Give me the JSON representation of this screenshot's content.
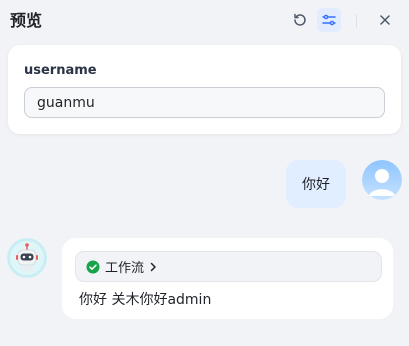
{
  "header": {
    "title": "预览",
    "refresh_icon": "refresh-icon",
    "settings_icon": "sliders-icon",
    "close_icon": "close-icon"
  },
  "variables": {
    "label": "username",
    "value": "guanmu"
  },
  "chat": {
    "user_message": "你好",
    "workflow_label": "工作流",
    "workflow_status": "success",
    "bot_message": "你好 关木你好admin"
  },
  "colors": {
    "accent": "#3370ff",
    "success": "#16a34a",
    "user_bubble": "#e1eeff",
    "background": "#f2f3f6"
  }
}
